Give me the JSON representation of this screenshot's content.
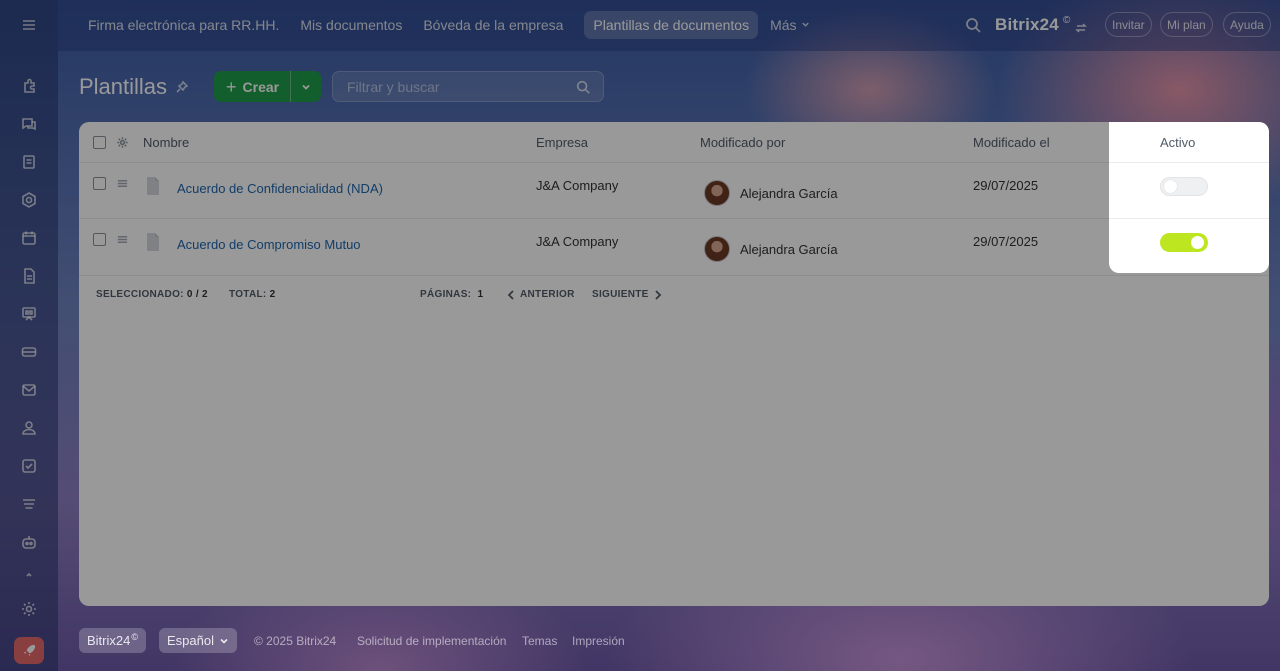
{
  "topnav": {
    "tabs": [
      {
        "label": "Firma electrónica para RR.HH."
      },
      {
        "label": "Mis documentos"
      },
      {
        "label": "Bóveda de la empresa"
      },
      {
        "label": "Plantillas de documentos"
      },
      {
        "label": "Más"
      }
    ],
    "brand": "Bitrix24",
    "brand_sup": "©",
    "invite": "Invitar",
    "plan": "Mi plan",
    "help": "Ayuda"
  },
  "page": {
    "title": "Plantillas",
    "create_label": "Crear",
    "filter_placeholder": "Filtrar y buscar"
  },
  "grid": {
    "columns": {
      "name": "Nombre",
      "company": "Empresa",
      "modified_by": "Modificado por",
      "modified_on": "Modificado el",
      "active": "Activo"
    },
    "rows": [
      {
        "name": "Acuerdo de Confidencialidad (NDA)",
        "company": "J&A Company",
        "modified_by": "Alejandra García",
        "modified_on": "29/07/2025",
        "active": false
      },
      {
        "name": "Acuerdo de Compromiso Mutuo",
        "company": "J&A Company",
        "modified_by": "Alejandra García",
        "modified_on": "29/07/2025",
        "active": true
      }
    ],
    "footer": {
      "selected_label": "SELECCIONADO:",
      "selected_value": "0 / 2",
      "total_label": "TOTAL:",
      "total_value": "2",
      "pages_label": "PÁGINAS:",
      "pages_value": "1",
      "prev": "ANTERIOR",
      "next": "SIGUIENTE"
    }
  },
  "colors": {
    "create_button": "#1f9d4a",
    "toggle_on": "#bde620",
    "link": "#2067b0"
  },
  "footer": {
    "brand": "Bitrix24",
    "brand_sup": "©",
    "language": "Español",
    "copyright": "© 2025 Bitrix24",
    "implementation": "Solicitud de implementación",
    "themes": "Temas",
    "print": "Impresión"
  }
}
